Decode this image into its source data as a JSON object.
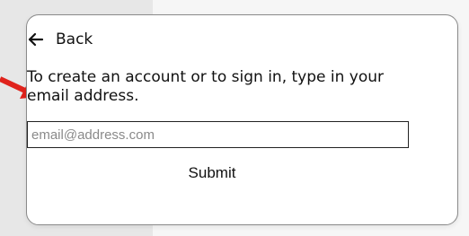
{
  "form": {
    "back_label": "Back",
    "instructions": "To create an account or to sign in, type in your email address.",
    "email_placeholder": "email@address.com",
    "email_value": "",
    "submit_label": "Submit"
  },
  "icons": {
    "back": "arrow-left-icon",
    "annotation": "red-arrow-icon"
  },
  "colors": {
    "annotation_arrow": "#e0231c",
    "card_border": "#8a8a8a",
    "text": "#111111"
  }
}
